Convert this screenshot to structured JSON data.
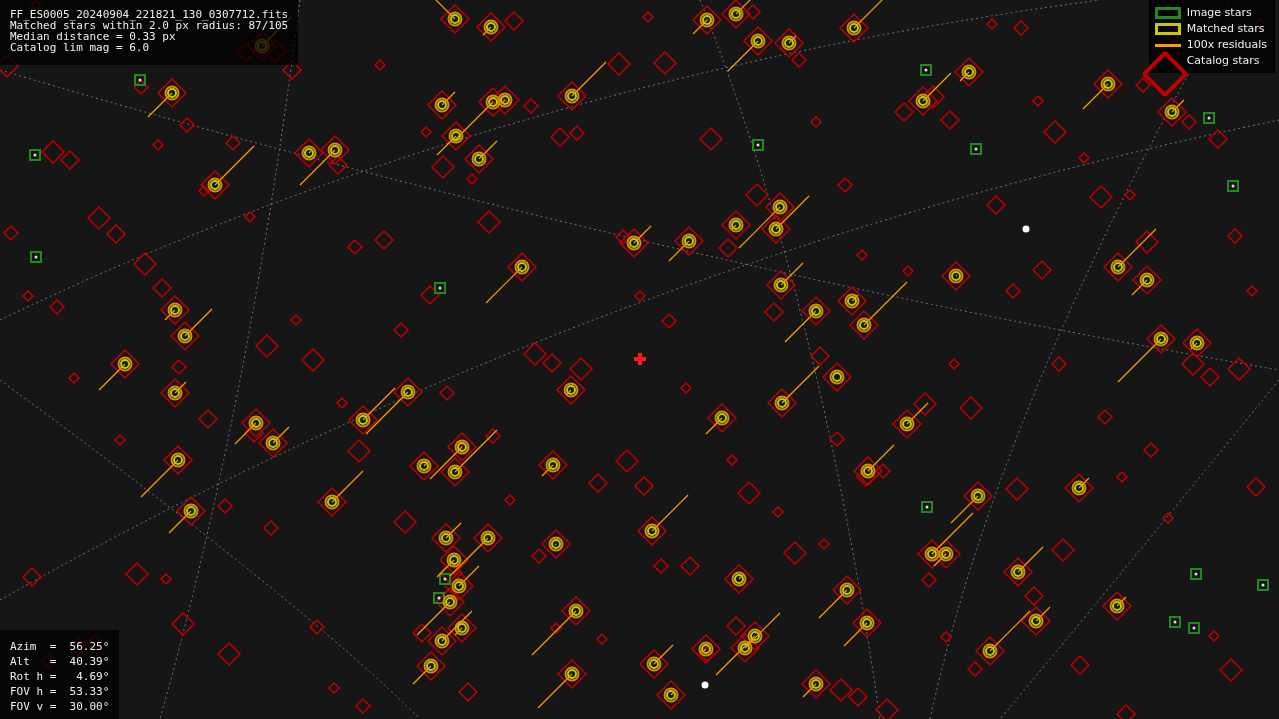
{
  "info_lines": [
    "FF_ES0005_20240904_221821_130_0307712.fits",
    "Matched stars within 2.0 px radius: 87/105",
    "Median distance = 0.33 px",
    "Catalog lim mag = 6.0"
  ],
  "legend": [
    {
      "label": "Image stars",
      "kind": "square",
      "color": "#1f8a1f"
    },
    {
      "label": "Matched stars",
      "kind": "square",
      "color": "#c8c800"
    },
    {
      "label": "100x residuals",
      "kind": "line",
      "color": "#ff9900"
    },
    {
      "label": "Catalog stars",
      "kind": "diamond",
      "color": "#c00000"
    }
  ],
  "pointing": [
    "Azim  =  56.25°",
    "Alt   =  40.39°",
    "Rot h =   4.69°",
    "FOV h =  53.33°",
    "FOV v =  30.00°"
  ]
}
